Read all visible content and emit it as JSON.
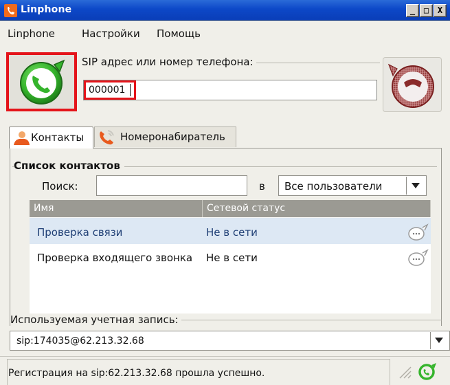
{
  "window": {
    "title": "Linphone",
    "minimize_glyph": "_",
    "maximize_glyph": "□",
    "close_glyph": "X"
  },
  "menu": {
    "items": [
      "Linphone",
      "Настройки",
      "Помощь"
    ]
  },
  "call": {
    "sip_label": "SIP адрес или номер телефона:",
    "sip_value": "000001",
    "call_icon": "green-phone-icon",
    "hangup_icon": "red-phone-icon"
  },
  "tabs": [
    {
      "label": "Контакты",
      "icon": "contacts-icon",
      "active": true
    },
    {
      "label": "Номеронабиратель",
      "icon": "dialer-icon",
      "active": false
    }
  ],
  "contacts": {
    "title": "Список контактов",
    "search_label": "Поиск:",
    "search_value": "",
    "in_label": "в",
    "group_selected": "Все пользователи",
    "columns": [
      "Имя",
      "Сетевой статус"
    ],
    "rows": [
      {
        "name": "Проверка связи",
        "status": "Не в сети",
        "selected": true
      },
      {
        "name": "Проверка входящего звонка",
        "status": "Не в сети",
        "selected": false
      }
    ]
  },
  "account": {
    "label": "Используемая учетная запись:",
    "selected": "sip:174035@62.213.32.68"
  },
  "status": {
    "text": "Регистрация на sip:62.213.32.68 прошла успешно."
  },
  "colors": {
    "titlebar": "#0d48c8",
    "highlight_red": "#e4141a",
    "call_green": "#35b42c",
    "hangup_red": "#9a2b2b",
    "selected_row": "#dde8f4"
  }
}
